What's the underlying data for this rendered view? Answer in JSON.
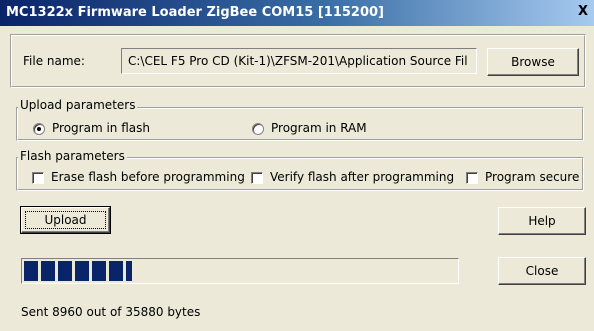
{
  "window": {
    "title": "MC1322x Firmware Loader ZigBee COM15 [115200]",
    "close_glyph": "X"
  },
  "file": {
    "label": "File name:",
    "value": "C:\\CEL F5 Pro CD (Kit-1)\\ZFSM-201\\Application Source Fil",
    "browse_label": "Browse"
  },
  "upload_params": {
    "title": "Upload parameters",
    "options": [
      {
        "label": "Program in flash",
        "selected": true
      },
      {
        "label": "Program in RAM",
        "selected": false
      }
    ]
  },
  "flash_params": {
    "title": "Flash parameters",
    "options": [
      {
        "label": "Erase flash before programming",
        "checked": false
      },
      {
        "label": "Verify flash after programming",
        "checked": false
      },
      {
        "label": "Program secure",
        "checked": false
      }
    ]
  },
  "buttons": {
    "upload": "Upload",
    "help": "Help",
    "close": "Close"
  },
  "progress": {
    "fraction": 0.2497,
    "color": "#0a246a"
  },
  "status": {
    "text": "Sent 8960 out of 35880 bytes"
  }
}
